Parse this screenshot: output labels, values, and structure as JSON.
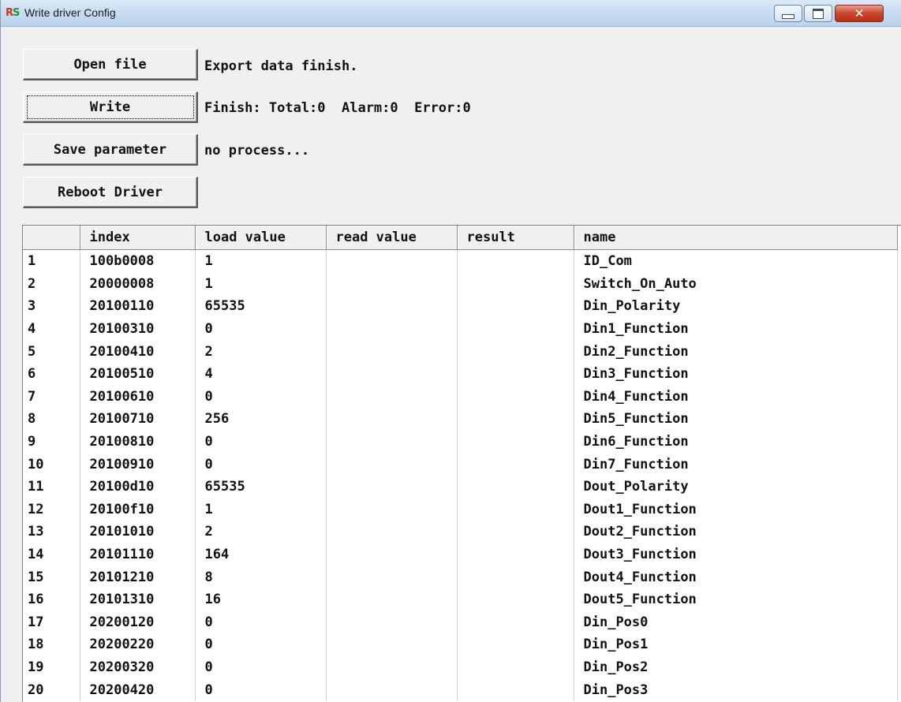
{
  "window": {
    "title": "Write driver Config",
    "close_glyph": "✕"
  },
  "actions": {
    "open_file": "Open file",
    "write": "Write",
    "save_parameter": "Save parameter",
    "reboot_driver": "Reboot Driver"
  },
  "status": {
    "open_file": "Export data finish.",
    "write": "Finish: Total:0  Alarm:0  Error:0",
    "save_parameter": "no process..."
  },
  "table": {
    "headers": [
      "",
      "index",
      "load value",
      "read value",
      "result",
      "name"
    ],
    "rows": [
      {
        "no": "1",
        "index": "100b0008",
        "load": "1",
        "read": "",
        "result": "",
        "name": "ID_Com"
      },
      {
        "no": "2",
        "index": "20000008",
        "load": "1",
        "read": "",
        "result": "",
        "name": "Switch_On_Auto"
      },
      {
        "no": "3",
        "index": "20100110",
        "load": "65535",
        "read": "",
        "result": "",
        "name": "Din_Polarity"
      },
      {
        "no": "4",
        "index": "20100310",
        "load": "0",
        "read": "",
        "result": "",
        "name": "Din1_Function"
      },
      {
        "no": "5",
        "index": "20100410",
        "load": "2",
        "read": "",
        "result": "",
        "name": "Din2_Function"
      },
      {
        "no": "6",
        "index": "20100510",
        "load": "4",
        "read": "",
        "result": "",
        "name": "Din3_Function"
      },
      {
        "no": "7",
        "index": "20100610",
        "load": "0",
        "read": "",
        "result": "",
        "name": "Din4_Function"
      },
      {
        "no": "8",
        "index": "20100710",
        "load": "256",
        "read": "",
        "result": "",
        "name": "Din5_Function"
      },
      {
        "no": "9",
        "index": "20100810",
        "load": "0",
        "read": "",
        "result": "",
        "name": "Din6_Function"
      },
      {
        "no": "10",
        "index": "20100910",
        "load": "0",
        "read": "",
        "result": "",
        "name": "Din7_Function"
      },
      {
        "no": "11",
        "index": "20100d10",
        "load": "65535",
        "read": "",
        "result": "",
        "name": "Dout_Polarity"
      },
      {
        "no": "12",
        "index": "20100f10",
        "load": "1",
        "read": "",
        "result": "",
        "name": "Dout1_Function"
      },
      {
        "no": "13",
        "index": "20101010",
        "load": "2",
        "read": "",
        "result": "",
        "name": "Dout2_Function"
      },
      {
        "no": "14",
        "index": "20101110",
        "load": "164",
        "read": "",
        "result": "",
        "name": "Dout3_Function"
      },
      {
        "no": "15",
        "index": "20101210",
        "load": "8",
        "read": "",
        "result": "",
        "name": "Dout4_Function"
      },
      {
        "no": "16",
        "index": "20101310",
        "load": "16",
        "read": "",
        "result": "",
        "name": "Dout5_Function"
      },
      {
        "no": "17",
        "index": "20200120",
        "load": "0",
        "read": "",
        "result": "",
        "name": "Din_Pos0"
      },
      {
        "no": "18",
        "index": "20200220",
        "load": "0",
        "read": "",
        "result": "",
        "name": "Din_Pos1"
      },
      {
        "no": "19",
        "index": "20200320",
        "load": "0",
        "read": "",
        "result": "",
        "name": "Din_Pos2"
      },
      {
        "no": "20",
        "index": "20200420",
        "load": "0",
        "read": "",
        "result": "",
        "name": "Din_Pos3"
      }
    ]
  }
}
